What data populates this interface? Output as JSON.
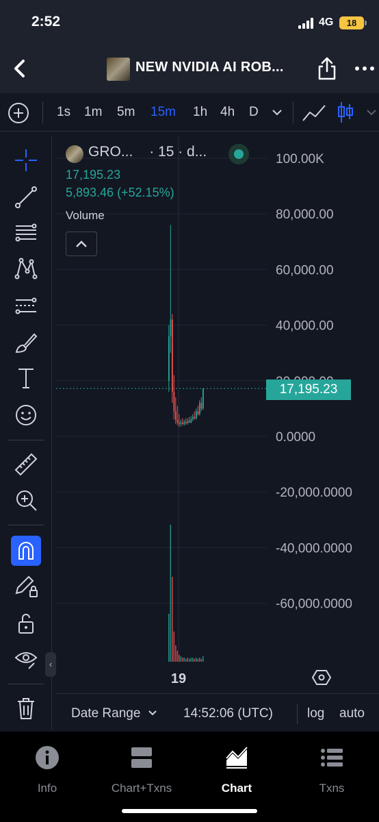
{
  "status": {
    "time": "2:52",
    "network": "4G",
    "battery": "18"
  },
  "header": {
    "title": "NEW NVIDIA AI ROB..."
  },
  "timeframes": [
    {
      "label": "1s",
      "active": false
    },
    {
      "label": "1m",
      "active": false
    },
    {
      "label": "5m",
      "active": false
    },
    {
      "label": "15m",
      "active": true
    },
    {
      "label": "1h",
      "active": false
    },
    {
      "label": "4h",
      "active": false
    },
    {
      "label": "D",
      "active": false
    }
  ],
  "legend": {
    "symbol": "GRO...",
    "interval": "· 15 · d...",
    "price": "17,195.23",
    "change": "5,893.46 (+52.15%)",
    "volume_label": "Volume"
  },
  "chart_data": {
    "type": "candlestick",
    "price_axis_ticks": [
      "100.00K",
      "80,000.00",
      "60,000.00",
      "40,000.00",
      "20,000.00",
      "0.0000",
      "-20,000.0000",
      "-40,000.0000",
      "-60,000.0000"
    ],
    "ylim": [
      -80000,
      100000
    ],
    "x_tick_labels": [
      "19"
    ],
    "last_price": 17195.23,
    "last_price_label": "17,195.23",
    "colors": {
      "up": "#26a69a",
      "down": "#ef5350",
      "volume": "#26a69a"
    },
    "candles": [
      {
        "o": 20000,
        "h": 40000,
        "l": 16000,
        "c": 36000
      },
      {
        "o": 36000,
        "h": 76000,
        "l": 30000,
        "c": 42000
      },
      {
        "o": 42000,
        "h": 44000,
        "l": 12000,
        "c": 16000
      },
      {
        "o": 16000,
        "h": 22000,
        "l": 6000,
        "c": 9000
      },
      {
        "o": 9000,
        "h": 14000,
        "l": 4500,
        "c": 6000
      },
      {
        "o": 6000,
        "h": 11000,
        "l": 4000,
        "c": 5000
      },
      {
        "o": 5000,
        "h": 8000,
        "l": 3500,
        "c": 4500
      },
      {
        "o": 4500,
        "h": 6000,
        "l": 3500,
        "c": 5000
      },
      {
        "o": 5000,
        "h": 6500,
        "l": 4000,
        "c": 4500
      },
      {
        "o": 4500,
        "h": 6000,
        "l": 3800,
        "c": 5200
      },
      {
        "o": 5200,
        "h": 6500,
        "l": 4200,
        "c": 4800
      },
      {
        "o": 4800,
        "h": 6500,
        "l": 4200,
        "c": 5500
      },
      {
        "o": 5500,
        "h": 7000,
        "l": 4800,
        "c": 5000
      },
      {
        "o": 5000,
        "h": 7200,
        "l": 4700,
        "c": 6200
      },
      {
        "o": 6200,
        "h": 8000,
        "l": 5500,
        "c": 7000
      },
      {
        "o": 7000,
        "h": 9000,
        "l": 6000,
        "c": 6500
      },
      {
        "o": 6500,
        "h": 10000,
        "l": 6000,
        "c": 9000
      },
      {
        "o": 9000,
        "h": 11000,
        "l": 7500,
        "c": 8000
      },
      {
        "o": 8000,
        "h": 13000,
        "l": 7500,
        "c": 12000
      },
      {
        "o": 12000,
        "h": 14000,
        "l": 9000,
        "c": 10000
      },
      {
        "o": 10000,
        "h": 17195.23,
        "l": 9500,
        "c": 17195.23
      }
    ],
    "volumes": [
      0.35,
      1.0,
      0.62,
      0.22,
      0.12,
      0.08,
      0.05,
      0.04,
      0.03,
      0.03,
      0.02,
      0.03,
      0.02,
      0.03,
      0.03,
      0.02,
      0.03,
      0.02,
      0.03,
      0.02,
      0.04
    ]
  },
  "footer": {
    "date_range": "Date Range",
    "clock": "14:52:06 (UTC)",
    "log": "log",
    "auto": "auto"
  },
  "bottom_nav": [
    {
      "label": "Info",
      "icon": "info-icon",
      "active": false
    },
    {
      "label": "Chart+Txns",
      "icon": "split-view-icon",
      "active": false
    },
    {
      "label": "Chart",
      "icon": "chart-icon",
      "active": true
    },
    {
      "label": "Txns",
      "icon": "list-icon",
      "active": false
    }
  ]
}
